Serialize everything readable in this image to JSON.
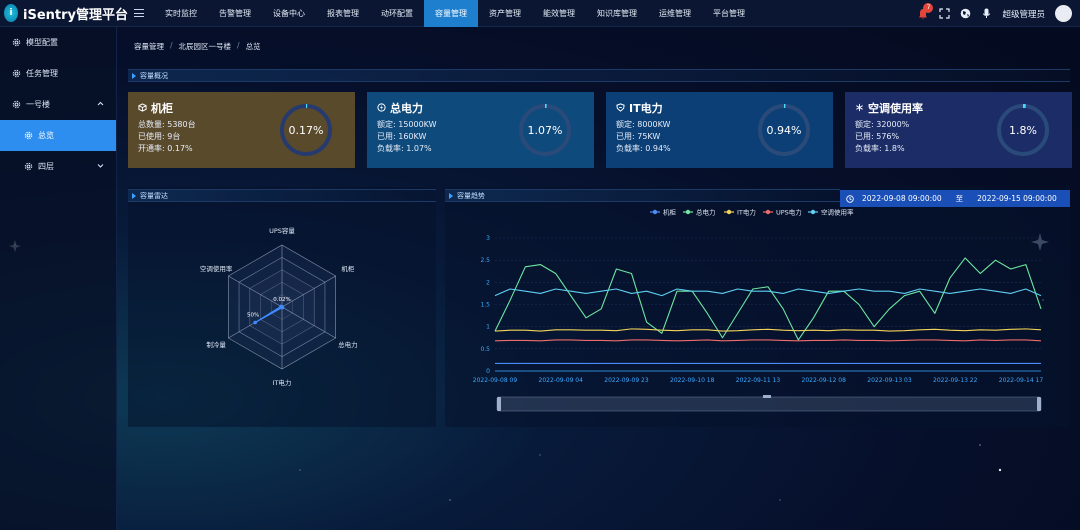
{
  "app": {
    "title": "iSentry管理平台",
    "logo_letter": "i"
  },
  "nav": {
    "items": [
      {
        "label": "实时监控"
      },
      {
        "label": "告警管理"
      },
      {
        "label": "设备中心"
      },
      {
        "label": "报表管理"
      },
      {
        "label": "动环配置"
      },
      {
        "label": "容量管理",
        "active": true
      },
      {
        "label": "资产管理"
      },
      {
        "label": "能效管理"
      },
      {
        "label": "知识库管理"
      },
      {
        "label": "运维管理"
      },
      {
        "label": "平台管理"
      }
    ]
  },
  "header_right": {
    "notification_count": "7",
    "user_name": "超级管理员"
  },
  "sidebar": {
    "items": [
      {
        "label": "模型配置"
      },
      {
        "label": "任务管理"
      },
      {
        "label": "一号楼"
      },
      {
        "label": "总览"
      },
      {
        "label": "四层"
      }
    ]
  },
  "breadcrumb": {
    "items": [
      "容量管理",
      "北辰园区一号楼",
      "总览"
    ],
    "separator": "/"
  },
  "sections": {
    "overview": "容量概况",
    "radar": "容量雷达",
    "trend": "容量趋势"
  },
  "cards": [
    {
      "title": "机柜",
      "icon": "cabinet-icon",
      "lines": [
        "总数量: 5380台",
        "已使用: 9台",
        "开通率: 0.17%"
      ],
      "percent_label": "0.17%",
      "percent": 0.17,
      "bg": "#5a4a2c",
      "ring": "#263a6e"
    },
    {
      "title": "总电力",
      "icon": "power-icon",
      "lines": [
        "额定: 15000KW",
        "已用: 160KW",
        "负载率: 1.07%"
      ],
      "percent_label": "1.07%",
      "percent": 1.07,
      "bg": "#0f4a7c",
      "ring": "#2a4a7a"
    },
    {
      "title": "IT电力",
      "icon": "shield-icon",
      "lines": [
        "额定: 8000KW",
        "已用: 75KW",
        "负载率: 0.94%"
      ],
      "percent_label": "0.94%",
      "percent": 0.94,
      "bg": "#0b3f76",
      "ring": "#2a4a7a"
    },
    {
      "title": "空调使用率",
      "icon": "snowflake-icon",
      "lines": [
        "额定: 32000%",
        "已用: 576%",
        "负载率: 1.8%"
      ],
      "percent_label": "1.8%",
      "percent": 1.8,
      "bg": "#1b2c66",
      "ring": "#2a4a7a"
    }
  ],
  "colors": {
    "accent": "#2d8ef0",
    "nav_active": "#1e7fcf",
    "date_bg": "#1a4fb8",
    "ring_highlight": "#4fd6ff"
  },
  "date_range": {
    "start": "2022-09-08 09:00:00",
    "separator": "至",
    "end": "2022-09-15 09:00:00"
  },
  "chart_data": [
    {
      "type": "radar",
      "indicators": [
        "UPS容量",
        "机柜",
        "总电力",
        "IT电力",
        "制冷量",
        "空调使用率"
      ],
      "center_label": "0.02%",
      "annotations": [
        "50%"
      ],
      "values": [
        0.02,
        0.17,
        1.07,
        0.94,
        50,
        1.8
      ]
    },
    {
      "type": "line",
      "legend": [
        "机柜",
        "总电力",
        "IT电力",
        "UPS电力",
        "空调使用率"
      ],
      "legend_colors": [
        "#4b8df8",
        "#6ee7a0",
        "#f2d35a",
        "#ef6b6b",
        "#5fd0f2"
      ],
      "x_ticks": [
        "2022-09-08 09",
        "2022-09-09 04",
        "2022-09-09 23",
        "2022-09-10 18",
        "2022-09-11 13",
        "2022-09-12 08",
        "2022-09-13 03",
        "2022-09-13 22",
        "2022-09-14 17"
      ],
      "ylim": [
        0,
        3
      ],
      "y_ticks": [
        "0",
        "0.5",
        "1",
        "1.5",
        "2",
        "2.5",
        "3"
      ],
      "series": [
        {
          "name": "机柜",
          "values": [
            0.17,
            0.17,
            0.17,
            0.17,
            0.17,
            0.17,
            0.17,
            0.17,
            0.17,
            0.17,
            0.17,
            0.17,
            0.17,
            0.17,
            0.17,
            0.17,
            0.17,
            0.17,
            0.17,
            0.17,
            0.17,
            0.17,
            0.17,
            0.17,
            0.17,
            0.17,
            0.17,
            0.17,
            0.17,
            0.17,
            0.17,
            0.17,
            0.17,
            0.17,
            0.17,
            0.17,
            0.17
          ]
        },
        {
          "name": "总电力",
          "values": [
            0.9,
            1.6,
            2.35,
            2.4,
            2.2,
            1.7,
            1.2,
            1.4,
            2.3,
            2.2,
            1.1,
            0.85,
            1.8,
            1.8,
            1.3,
            0.75,
            1.3,
            1.85,
            1.9,
            1.4,
            0.7,
            1.2,
            1.8,
            1.8,
            1.5,
            1.0,
            1.4,
            1.7,
            1.8,
            1.3,
            2.1,
            2.55,
            2.2,
            2.5,
            2.3,
            2.4,
            1.4
          ]
        },
        {
          "name": "IT电力",
          "values": [
            0.9,
            0.92,
            0.92,
            0.9,
            0.93,
            0.93,
            0.92,
            0.92,
            0.91,
            0.95,
            0.94,
            0.92,
            0.91,
            0.93,
            0.93,
            0.9,
            0.91,
            0.93,
            0.94,
            0.92,
            0.91,
            0.92,
            0.91,
            0.93,
            0.92,
            0.92,
            0.9,
            0.91,
            0.93,
            0.94,
            0.92,
            0.91,
            0.93,
            0.92,
            0.94,
            0.95,
            0.93
          ]
        },
        {
          "name": "UPS电力",
          "values": [
            0.68,
            0.69,
            0.69,
            0.68,
            0.7,
            0.7,
            0.69,
            0.69,
            0.68,
            0.7,
            0.7,
            0.69,
            0.68,
            0.69,
            0.7,
            0.68,
            0.69,
            0.7,
            0.7,
            0.69,
            0.68,
            0.69,
            0.69,
            0.7,
            0.69,
            0.69,
            0.68,
            0.69,
            0.7,
            0.7,
            0.69,
            0.68,
            0.7,
            0.69,
            0.7,
            0.7,
            0.68
          ]
        },
        {
          "name": "空调使用率",
          "values": [
            1.7,
            1.85,
            1.8,
            1.75,
            1.85,
            1.8,
            1.75,
            1.8,
            1.85,
            1.75,
            1.8,
            1.7,
            1.85,
            1.8,
            1.8,
            1.75,
            1.85,
            1.8,
            1.8,
            1.75,
            1.85,
            1.8,
            1.75,
            1.8,
            1.85,
            1.8,
            1.8,
            1.75,
            1.85,
            1.8,
            1.75,
            1.8,
            1.85,
            1.8,
            1.75,
            1.85,
            1.7
          ]
        }
      ]
    }
  ]
}
